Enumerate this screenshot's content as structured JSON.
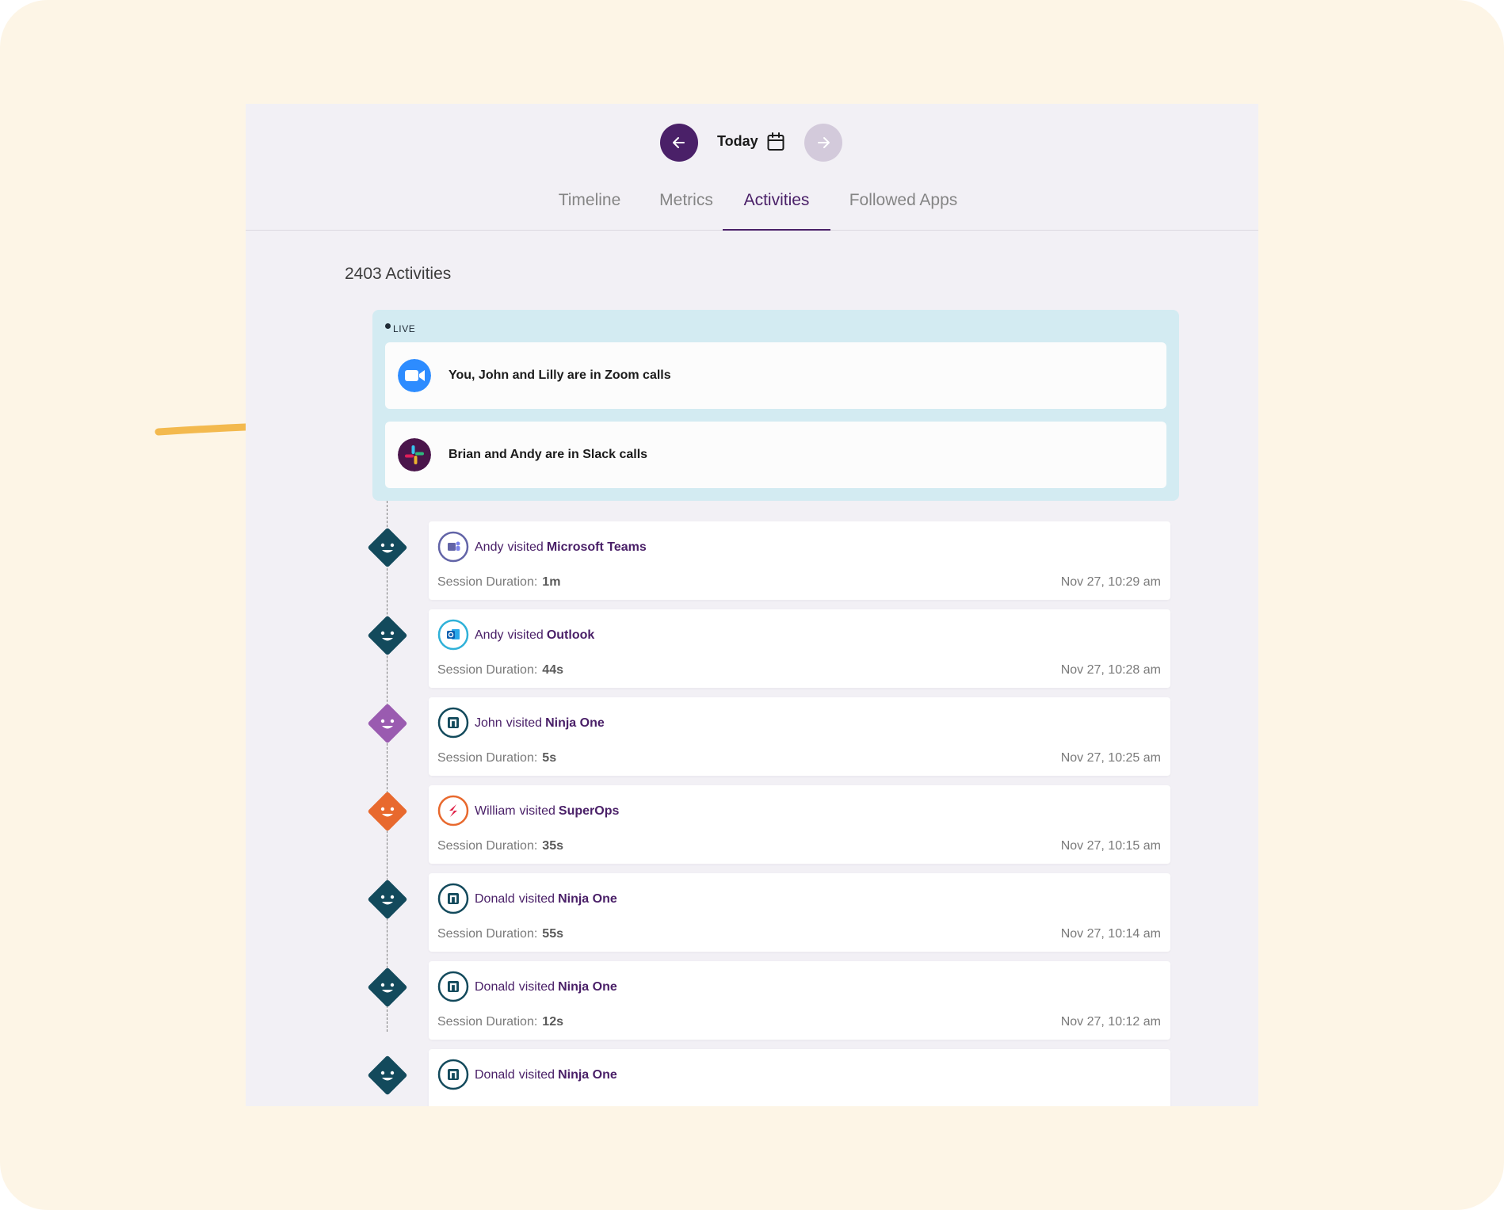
{
  "nav": {
    "date_label": "Today",
    "prev_icon": "arrow-left-icon",
    "next_icon": "arrow-right-icon",
    "calendar_icon": "calendar-icon"
  },
  "tabs": [
    {
      "label": "Timeline",
      "active": false
    },
    {
      "label": "Metrics",
      "active": false
    },
    {
      "label": "Activities",
      "active": true
    },
    {
      "label": "Followed Apps",
      "active": false
    }
  ],
  "activity_count": "2403 Activities",
  "live": {
    "label": "LIVE",
    "items": [
      {
        "app": "zoom-icon",
        "text": "You, John and Lilly are in Zoom calls"
      },
      {
        "app": "slack-icon",
        "text": "Brian and Andy are in Slack calls"
      }
    ]
  },
  "activities": [
    {
      "user": "Andy",
      "verb": "visited",
      "app": "Microsoft Teams",
      "duration_label": "Session Duration:",
      "duration": "1m",
      "time": "Nov 27, 10:29 am",
      "avatar_color": "#134a5c",
      "icon": "microsoft-teams-icon"
    },
    {
      "user": "Andy",
      "verb": "visited",
      "app": "Outlook",
      "duration_label": "Session Duration:",
      "duration": "44s",
      "time": "Nov 27, 10:28 am",
      "avatar_color": "#134a5c",
      "icon": "outlook-icon"
    },
    {
      "user": "John",
      "verb": "visited",
      "app": "Ninja One",
      "duration_label": "Session Duration:",
      "duration": "5s",
      "time": "Nov 27, 10:25 am",
      "avatar_color": "#9a5bb0",
      "icon": "ninja-one-icon"
    },
    {
      "user": "William",
      "verb": "visited",
      "app": "SuperOps",
      "duration_label": "Session Duration:",
      "duration": "35s",
      "time": "Nov 27, 10:15 am",
      "avatar_color": "#e8692e",
      "icon": "superops-icon"
    },
    {
      "user": "Donald",
      "verb": "visited",
      "app": "Ninja One",
      "duration_label": "Session Duration:",
      "duration": "55s",
      "time": "Nov 27, 10:14 am",
      "avatar_color": "#134a5c",
      "icon": "ninja-one-icon"
    },
    {
      "user": "Donald",
      "verb": "visited",
      "app": "Ninja One",
      "duration_label": "Session Duration:",
      "duration": "12s",
      "time": "Nov 27, 10:12 am",
      "avatar_color": "#134a5c",
      "icon": "ninja-one-icon"
    },
    {
      "user": "Donald",
      "verb": "visited",
      "app": "Ninja One",
      "duration_label": "",
      "duration": "",
      "time": "",
      "avatar_color": "#134a5c",
      "icon": "ninja-one-icon"
    }
  ],
  "colors": {
    "brand": "#4a2068",
    "live_bg": "#d3ebf2",
    "outer_bg": "#fdf5e6",
    "panel_bg": "#f2f0f5",
    "arrow": "#f2b33d"
  }
}
